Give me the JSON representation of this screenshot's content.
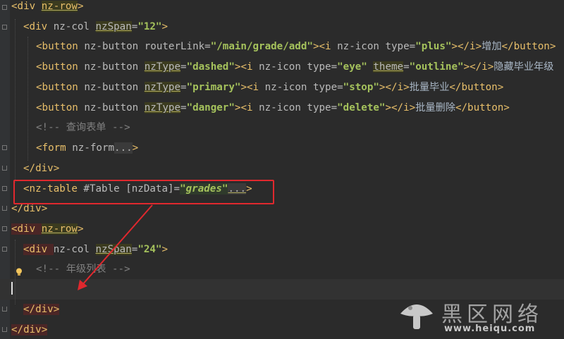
{
  "code": {
    "line1": {
      "open": "<div ",
      "attr": "nz-row",
      "close": ">"
    },
    "line2": {
      "open": "<div ",
      "attr1": "nz-col ",
      "attr2": "nzSpan",
      "eq": "=",
      "val": "\"12\"",
      "close": ">"
    },
    "line3": {
      "b_open": "<button ",
      "attrs": "nz-button routerLink=",
      "val": "\"/main/grade/add\"",
      "i_open": "><i ",
      "i_attr": "nz-icon type=",
      "i_val": "\"plus\"",
      "i_close": "></i>",
      "text": "增加",
      "b_close": "</button>"
    },
    "line4": {
      "b_open": "<button ",
      "attr1": "nz-button ",
      "attr2": "nzType",
      "eq": "=",
      "val": "\"dashed\"",
      "i_open": "><i ",
      "i_attr": "nz-icon type=",
      "i_val": "\"eye\"",
      "sp": " ",
      "theme": "theme",
      "theme_eq": "=",
      "theme_val": "\"outline\"",
      "i_close": "></i>",
      "text": "隐藏毕业年级"
    },
    "line5": {
      "b_open": "<button ",
      "attr1": "nz-button ",
      "attr2": "nzType",
      "eq": "=",
      "val": "\"primary\"",
      "i_open": "><i ",
      "i_attr": "nz-icon type=",
      "i_val": "\"stop\"",
      "i_close": "></i>",
      "text": "批量毕业",
      "b_close": "</button>"
    },
    "line6": {
      "b_open": "<button ",
      "attr1": "nz-button ",
      "attr2": "nzType",
      "eq": "=",
      "val": "\"danger\"",
      "i_open": "><i ",
      "i_attr": "nz-icon type=",
      "i_val": "\"delete\"",
      "i_close": "></i>",
      "text": "批量删除",
      "b_close": "</button>"
    },
    "line7": {
      "comment": "<!-- 查询表单 -->"
    },
    "line8": {
      "open": "<form ",
      "attr": "nz-form",
      "dots": "...",
      "close": ">"
    },
    "line9": {
      "close": "</div>"
    },
    "line10": {
      "open": "<nz-table ",
      "attr": "#Table [nzData]=",
      "val": "\"grades\"",
      "dots": "...",
      "close": ">"
    },
    "line11": {
      "close": "</div>"
    },
    "line12": {
      "open": "<div ",
      "attr": "nz-row",
      "close": ">"
    },
    "line13": {
      "open": "<div ",
      "attr1": "nz-col ",
      "attr2": "nzSpan",
      "eq": "=",
      "val": "\"24\"",
      "close": ">"
    },
    "line14": {
      "comment": "<!-- 年级列表 -->"
    },
    "line16": {
      "close": "</div>"
    },
    "line17": {
      "close": "</div>"
    }
  },
  "watermark": {
    "title": "黑区网络",
    "url": "www.heiqu.com"
  },
  "colors": {
    "background": "#2b2b2b",
    "tag": "#e8bf6a",
    "string": "#a5c25c",
    "comment": "#808080",
    "annotation": "#e0282e"
  },
  "icons": [
    "lightbulb-icon",
    "fold-marker-icon",
    "mushroom-logo-icon"
  ]
}
